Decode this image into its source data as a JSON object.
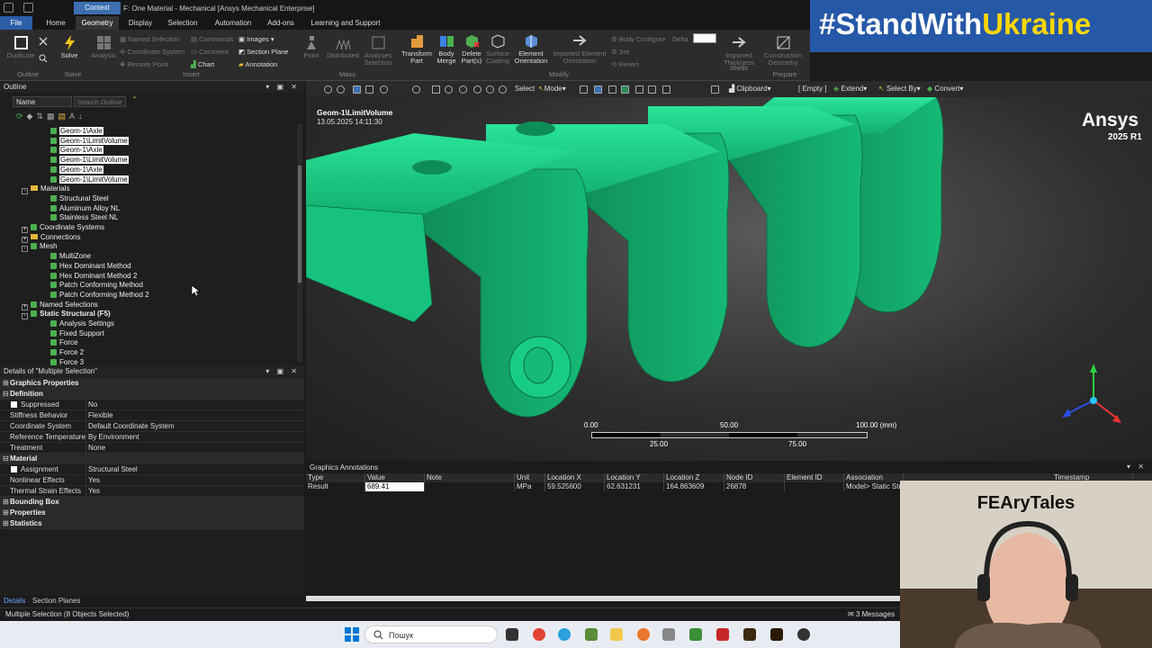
{
  "titlebar": {
    "context_tab": "Context",
    "title": "F: One Material - Mechanical [Ansys Mechanical Enterprise]"
  },
  "menu": {
    "tabs": [
      "File",
      "Home",
      "Geometry",
      "Display",
      "Selection",
      "Automation",
      "Add-ons",
      "Learning and Support"
    ],
    "active": "Geometry"
  },
  "ribbon": {
    "outline_group": {
      "duplicate": "Duplicate",
      "label": "Outline"
    },
    "solve_group": {
      "solve": "Solve",
      "analysis": "Analysis",
      "label": "Solve"
    },
    "insert_group": {
      "named_selection": "Named Selection",
      "coordinate_system": "Coordinate System",
      "remote_point": "Remote Point",
      "commands": "Commands",
      "comment": "Comment",
      "chart": "Chart",
      "images": "Images",
      "section_plane": "Section Plane",
      "annotation": "Annotation",
      "label": "Insert"
    },
    "mass_group": {
      "point": "Point",
      "distributed": "Distributed",
      "analyses_selection": "Analyses Selection",
      "label": "Mass"
    },
    "modify_group": {
      "transform_part": "Transform Part",
      "body_merge": "Body Merge",
      "delete_parts": "Delete Part(s)",
      "surface_coating": "Surface Coating",
      "element_orientation": "Element Orientation",
      "imported_element_orientation": "Imported Element Orientation",
      "label": "Modify"
    },
    "misc": {
      "body_configure": "Body Configure",
      "delta": "Delta",
      "set": "Set",
      "revert": "Revert"
    },
    "prepare_group": {
      "imported_thickness": "Imported Thickness",
      "shells": "Shells",
      "construction_geometry": "Construction Geometry",
      "label": "Prepare"
    }
  },
  "banner": {
    "prefix": "#StandWith",
    "highlight": "Ukraine"
  },
  "outline": {
    "title": "Outline",
    "filter_label": "Name",
    "search_placeholder": "Search Outline",
    "tree": [
      {
        "label": "Geom-1\\Axle",
        "sel": true,
        "lvl": 3,
        "ic": "g"
      },
      {
        "label": "Geom-1\\LimitVolume",
        "sel": true,
        "lvl": 3,
        "ic": "g"
      },
      {
        "label": "Geom-1\\Axle",
        "sel": true,
        "lvl": 3,
        "ic": "g"
      },
      {
        "label": "Geom-1\\LimitVolume",
        "sel": true,
        "lvl": 3,
        "ic": "g"
      },
      {
        "label": "Geom-1\\Axle",
        "sel": true,
        "lvl": 3,
        "ic": "g"
      },
      {
        "label": "Geom-1\\LimitVolume",
        "sel": true,
        "lvl": 3,
        "ic": "g"
      },
      {
        "label": "Materials",
        "lvl": 2,
        "ic": "f",
        "exp": "-"
      },
      {
        "label": "Structural Steel",
        "lvl": 3,
        "ic": "g"
      },
      {
        "label": "Aluminum Alloy NL",
        "lvl": 3,
        "ic": "g"
      },
      {
        "label": "Stainless Steel NL",
        "lvl": 3,
        "ic": "g"
      },
      {
        "label": "Coordinate Systems",
        "lvl": 2,
        "ic": "g",
        "exp": "+"
      },
      {
        "label": "Connections",
        "lvl": 2,
        "ic": "f",
        "exp": "+"
      },
      {
        "label": "Mesh",
        "lvl": 2,
        "ic": "g",
        "exp": "-"
      },
      {
        "label": "MultiZone",
        "lvl": 3,
        "ic": "g"
      },
      {
        "label": "Hex Dominant Method",
        "lvl": 3,
        "ic": "g"
      },
      {
        "label": "Hex Dominant Method 2",
        "lvl": 3,
        "ic": "g"
      },
      {
        "label": "Patch Conforming Method",
        "lvl": 3,
        "ic": "g"
      },
      {
        "label": "Patch Conforming Method 2",
        "lvl": 3,
        "ic": "g"
      },
      {
        "label": "Named Selections",
        "lvl": 2,
        "ic": "g",
        "exp": "+"
      },
      {
        "label": "Static Structural (F5)",
        "lvl": 2,
        "ic": "g",
        "exp": "-",
        "bold": true
      },
      {
        "label": "Analysis Settings",
        "lvl": 3,
        "ic": "g"
      },
      {
        "label": "Fixed Support",
        "lvl": 3,
        "ic": "g"
      },
      {
        "label": "Force",
        "lvl": 3,
        "ic": "g"
      },
      {
        "label": "Force 2",
        "lvl": 3,
        "ic": "g"
      },
      {
        "label": "Force 3",
        "lvl": 3,
        "ic": "g"
      }
    ]
  },
  "details": {
    "title": "Details of \"Multiple Selection\"",
    "rows": [
      {
        "g": true,
        "pm": "+",
        "k": "Graphics Properties"
      },
      {
        "g": true,
        "pm": "-",
        "k": "Definition"
      },
      {
        "k": "Suppressed",
        "v": "No",
        "chk": true
      },
      {
        "k": "Stiffness Behavior",
        "v": "Flexible"
      },
      {
        "k": "Coordinate System",
        "v": "Default Coordinate System"
      },
      {
        "k": "Reference Temperature",
        "v": "By Environment"
      },
      {
        "k": "Treatment",
        "v": "None"
      },
      {
        "g": true,
        "pm": "-",
        "k": "Material"
      },
      {
        "k": "Assignment",
        "v": "Structural Steel",
        "chk": true
      },
      {
        "k": "Nonlinear Effects",
        "v": "Yes"
      },
      {
        "k": "Thermal Strain Effects",
        "v": "Yes"
      },
      {
        "g": true,
        "pm": "+",
        "k": "Bounding Box"
      },
      {
        "g": true,
        "pm": "+",
        "k": "Properties"
      },
      {
        "g": true,
        "pm": "+",
        "k": "Statistics"
      }
    ],
    "bottom_tabs": [
      "Details",
      "Section Planes"
    ]
  },
  "viewer": {
    "toolbar": {
      "select": "Select",
      "mode": "Mode",
      "clipboard": "Clipboard",
      "empty": "[ Empty ]",
      "extend": "Extend",
      "select_by": "Select By",
      "convert": "Convert"
    },
    "geom_title": "Geom-1\\LimitVolume",
    "geom_date": "13.05.2025 14:11:30",
    "brand": "Ansys",
    "version": "2025 R1",
    "scale": {
      "top": [
        "0.00",
        "50.00",
        "100.00 (mm)"
      ],
      "bottom": [
        "25.00",
        "75.00"
      ]
    },
    "colors": {
      "part": "#1fd38b"
    }
  },
  "annotations": {
    "title": "Graphics Annotations",
    "headers": [
      "Type",
      "Value",
      "Note",
      "Unit",
      "Location X",
      "Location Y",
      "Location Z",
      "Node ID",
      "Element ID",
      "Association",
      "Timestamp"
    ],
    "row": [
      "Result",
      "689.41",
      "",
      "MPa",
      "59.525600",
      "62.631231",
      "164.863609",
      "26878",
      "",
      "Model> Static Str",
      ""
    ]
  },
  "status": {
    "left": "Multiple Selection (8 Objects Selected)",
    "messages": "3 Messages"
  },
  "taskbar": {
    "search": "Пошук"
  },
  "webcam": {
    "caption": "FEAryTales"
  }
}
